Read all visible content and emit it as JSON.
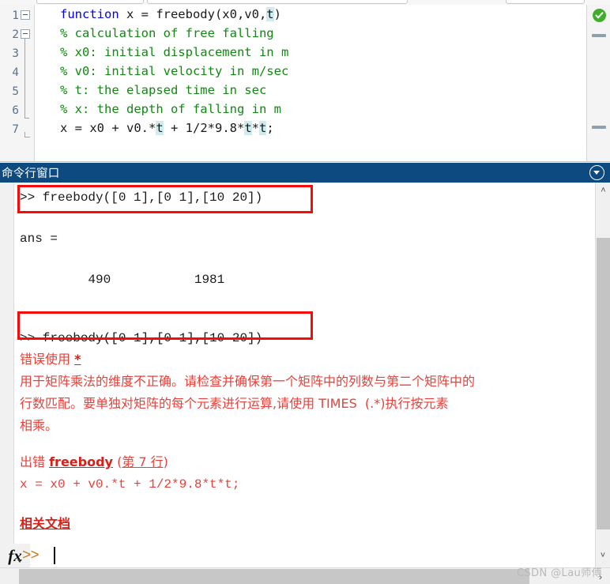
{
  "editor": {
    "line_numbers": [
      "1",
      "2",
      "3",
      "4",
      "5",
      "6",
      "7"
    ],
    "lines": [
      {
        "n": "1",
        "plain": "function x = freebody(x0,v0,t)"
      },
      {
        "n": "2",
        "plain": "% calculation of free falling"
      },
      {
        "n": "3",
        "plain": "% x0: initial displacement in m"
      },
      {
        "n": "4",
        "plain": "% v0: initial velocity in m/sec"
      },
      {
        "n": "5",
        "plain": "% t: the elapsed time in sec"
      },
      {
        "n": "6",
        "plain": "% x: the depth of falling in m"
      },
      {
        "n": "7",
        "plain": "x = x0 + v0.*t + 1/2*9.8*t*t;"
      }
    ],
    "status_icon": "checkmark-ok-icon",
    "keyword": "function",
    "fn_signature": " x = freebody(x0,v0,",
    "highlight_var": "t",
    "line1_tail": ")",
    "comment2": "% calculation of free falling",
    "comment3": "% x0: initial displacement in m",
    "comment4": "% v0: initial velocity in m/sec",
    "comment5": "% t: the elapsed time in sec",
    "comment6": "% x: the depth of falling in m",
    "line7_a": "x = x0 + v0.*",
    "line7_b": " + 1/2*9.8*",
    "line7_c": "*",
    "line7_d": ";"
  },
  "command_window": {
    "title": "命令行窗口",
    "collapse_icon": "chevron-down-circle-icon",
    "command1": ">> freebody([0 1],[0 1],[10 20])",
    "ans_label": "ans =",
    "ans_values": "         490           1981",
    "command2": ">> freebody([0 1],[0 1],[10 20])",
    "error_head_label": "错误使用 ",
    "error_head_link": "*",
    "error_body_line1": "用于矩阵乘法的维度不正确。请检查并确保第一个矩阵中的列数与第二个矩阵中的",
    "error_body_line2": "行数匹配。要单独对矩阵的每个元素进行运算,请使用 TIMES  (.*)执行按元素",
    "error_body_line3": "相乘。",
    "error_loc_prefix": "出错 ",
    "error_loc_link": "freebody",
    "error_loc_open": " (",
    "error_loc_line": "第 7 行",
    "error_loc_close": ")",
    "error_source_line": "x = x0 + v0.*t + 1/2*9.8*t*t;",
    "related_docs_link": "相关文档"
  },
  "prompt": {
    "fx_label": "fx",
    "chevrons": ">>",
    "value": "",
    "placeholder": ""
  },
  "scrollbars": {
    "up_arrow": "˄",
    "down_arrow": "˅",
    "left_arrow": "‹",
    "right_arrow": "›"
  },
  "watermark": "CSDN @Lau师傅",
  "colors": {
    "title_bar": "#0d4a80",
    "keyword_blue": "#0000ee",
    "comment_green": "#118811",
    "error_red": "#e8403a",
    "annotation_red": "#f50b0b",
    "highlight_cyan": "#ceecee",
    "ok_green": "#3fae2a"
  }
}
